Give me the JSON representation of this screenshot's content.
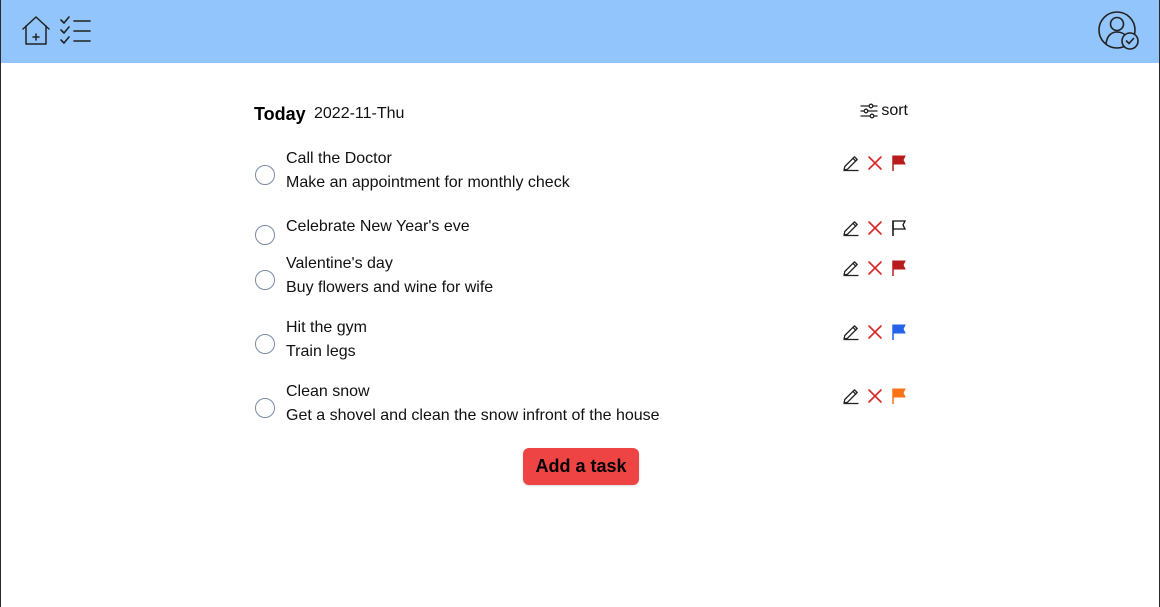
{
  "navbar": {
    "home_icon": "home-add-icon",
    "tasks_icon": "checklist-icon",
    "profile_icon": "user-check-icon",
    "background": "#93c5fd"
  },
  "header": {
    "title": "Today",
    "date": "2022-11-Thu",
    "sort_label": "sort"
  },
  "tasks": [
    {
      "title": "Call the Doctor",
      "description": "Make an appointment for monthly check",
      "flag_color": "#b91c1c",
      "flagged": true
    },
    {
      "title": "Celebrate New Year's eve",
      "description": "",
      "flag_color": "#111111",
      "flagged": false
    },
    {
      "title": "Valentine's day",
      "description": "Buy flowers and wine for wife",
      "flag_color": "#b91c1c",
      "flagged": true
    },
    {
      "title": "Hit the gym",
      "description": "Train legs",
      "flag_color": "#2563eb",
      "flagged": true
    },
    {
      "title": "Clean snow",
      "description": "Get a shovel and clean the snow infront of the house",
      "flag_color": "#f97316",
      "flagged": true
    }
  ],
  "add_button_label": "Add a task",
  "colors": {
    "delete": "#dc2626",
    "add_button": "#ef4444"
  }
}
